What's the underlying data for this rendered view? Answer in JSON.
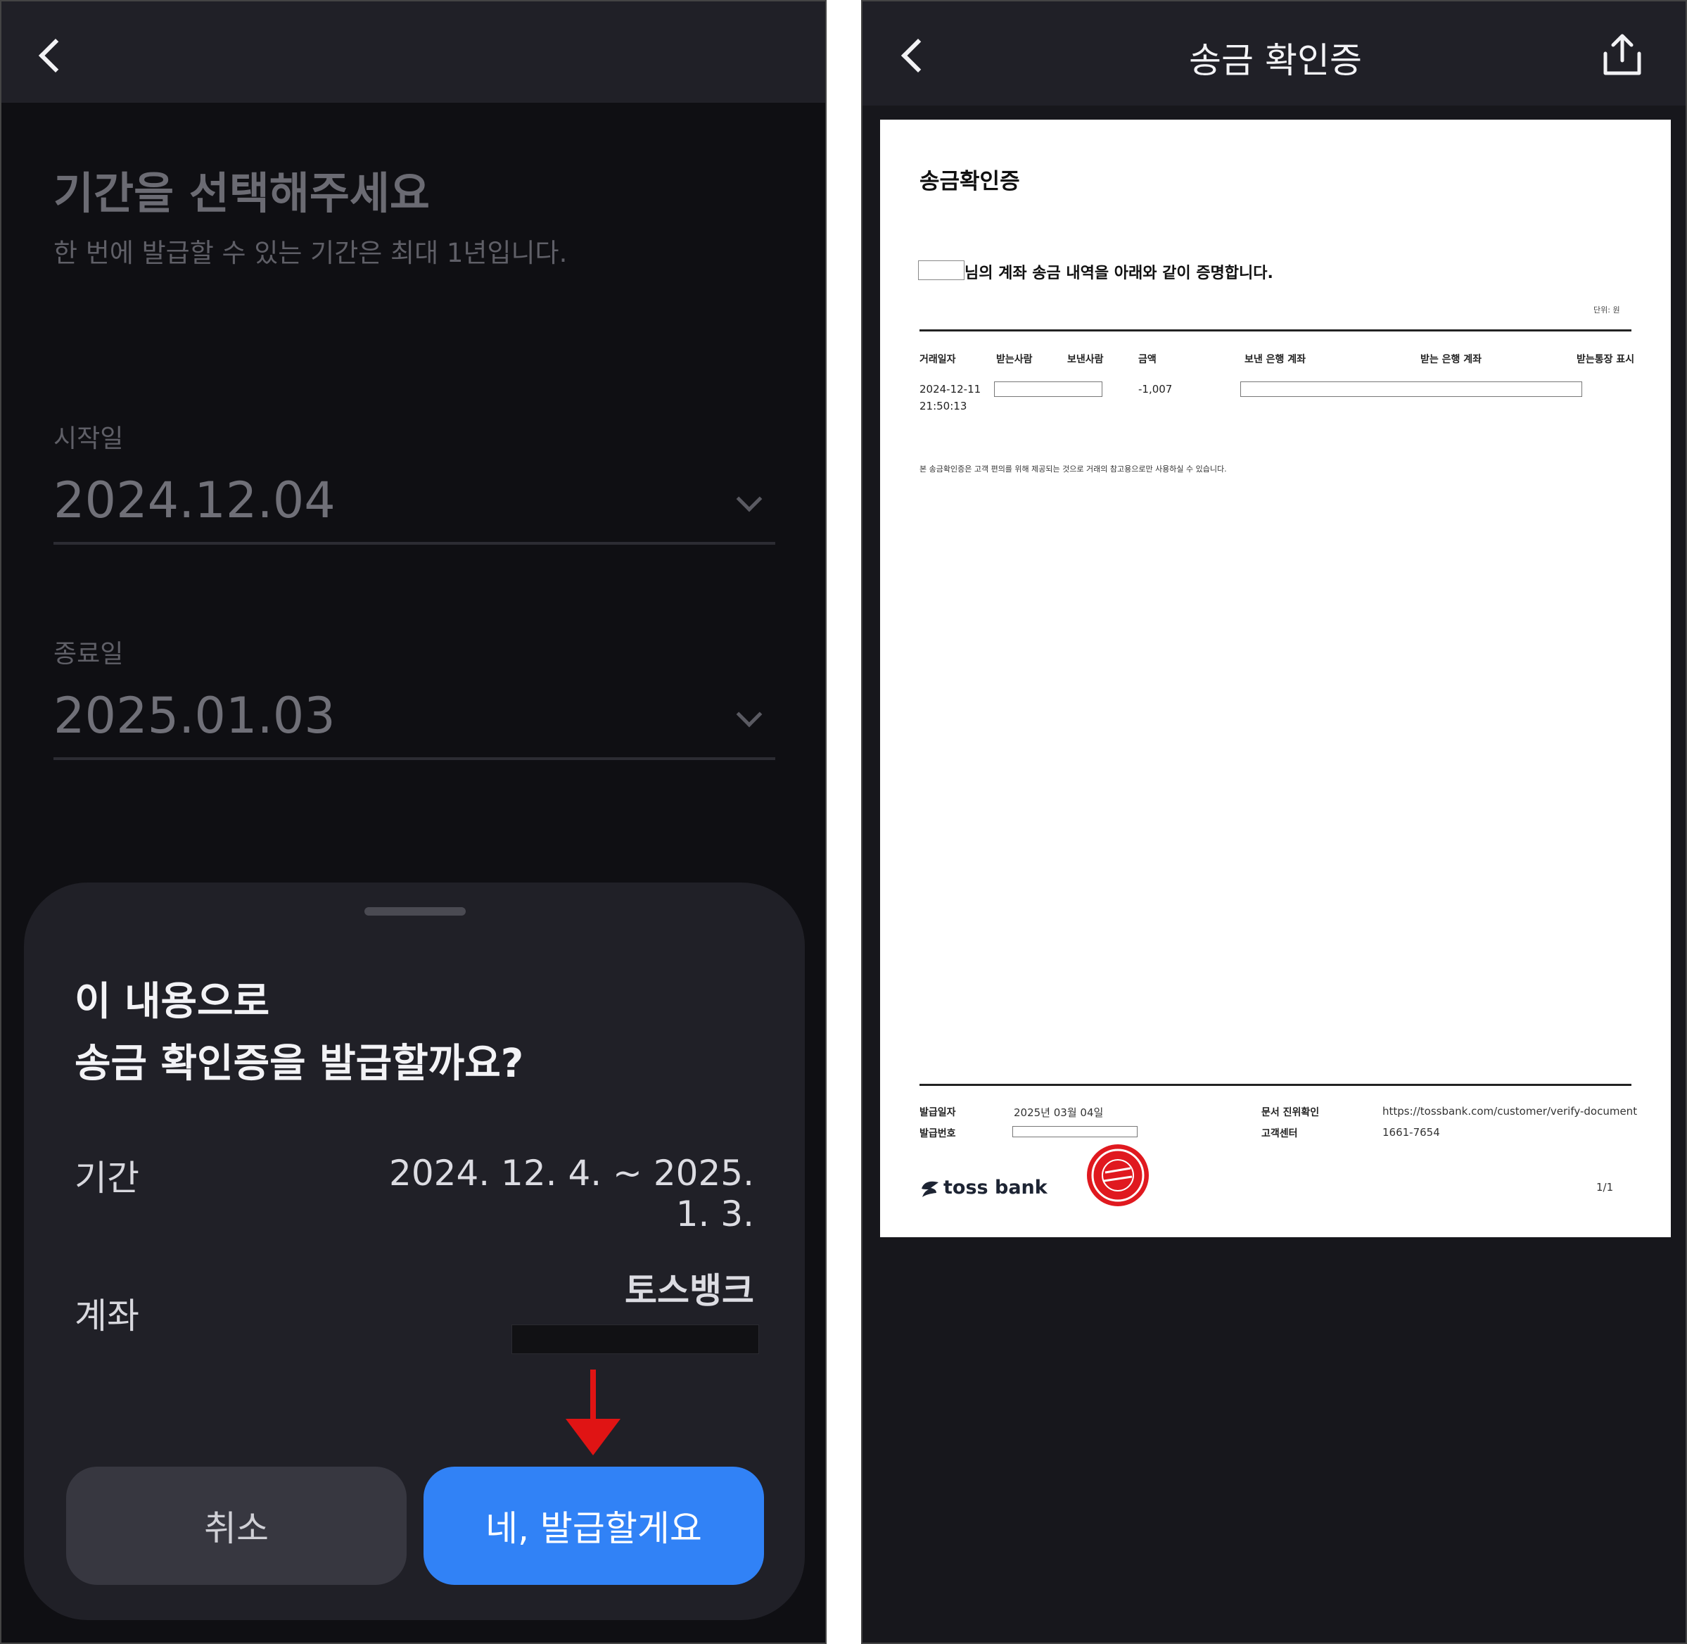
{
  "left": {
    "title": "기간을 선택해주세요",
    "subtitle": "한 번에 발급할 수 있는 기간은 최대 1년입니다.",
    "start": {
      "label": "시작일",
      "value": "2024.12.04"
    },
    "end": {
      "label": "종료일",
      "value": "2025.01.03"
    },
    "sheet": {
      "title_line1": "이 내용으로",
      "title_line2": "송금 확인증을 발급할까요?",
      "period_label": "기간",
      "period_value": "2024. 12. 4. ~ 2025. 1. 3.",
      "account_label": "계좌",
      "account_bank": "토스뱅크",
      "cancel_label": "취소",
      "confirm_label": "네, 발급할게요"
    }
  },
  "right": {
    "title": "송금 확인증",
    "doc": {
      "title": "송금확인증",
      "cert_text": "님의 계좌 송금 내역을 아래와 같이 증명합니다.",
      "unit": "단위: 원",
      "headers": {
        "date": "거래일자",
        "receiver": "받는사람",
        "sender": "보낸사람",
        "amount": "금액",
        "send_account": "보낸 은행 계좌",
        "recv_account": "받는 은행 계좌",
        "recv_display": "받는통장 표시"
      },
      "row": {
        "date": "2024-12-11",
        "time": "21:50:13",
        "amount": "-1,007"
      },
      "notice": "본 송금확인증은 고객 편의를 위해 제공되는 것으로 거래의 참고용으로만 사용하실 수 있습니다.",
      "footer": {
        "issue_date_label": "발급일자",
        "issue_date": "2025년 03월 04일",
        "issue_no_label": "발급번호",
        "verify_label": "문서 진위확인",
        "verify_url": "https://tossbank.com/customer/verify-document",
        "center_label": "고객센터",
        "center_phone": "1661-7654",
        "logo_text": "toss bank",
        "page": "1/1"
      }
    }
  },
  "colors": {
    "primary_blue": "#3182f6",
    "sheet_bg": "#202027",
    "arrow_red": "#e01414",
    "stamp_red": "#e0191f"
  },
  "icons": [
    "chevron-left-icon",
    "chevron-down-icon",
    "share-icon",
    "arrow-down-icon",
    "toss-logo-icon",
    "stamp-icon"
  ]
}
